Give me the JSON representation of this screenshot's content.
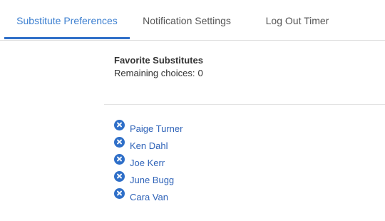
{
  "tabs": [
    {
      "label": "Substitute Preferences",
      "active": true
    },
    {
      "label": "Notification Settings",
      "active": false
    },
    {
      "label": "Log Out Timer",
      "active": false
    }
  ],
  "favorites": {
    "title": "Favorite Substitutes",
    "remaining_label": "Remaining choices:",
    "remaining_count": "0",
    "substitutes": [
      {
        "name": "Paige Turner",
        "remove_icon": "close-circle-icon"
      },
      {
        "name": "Ken Dahl",
        "remove_icon": "close-circle-icon"
      },
      {
        "name": "Joe Kerr",
        "remove_icon": "close-circle-icon"
      },
      {
        "name": "June Bugg",
        "remove_icon": "close-circle-icon"
      },
      {
        "name": "Cara Van",
        "remove_icon": "close-circle-icon"
      }
    ]
  },
  "colors": {
    "accent": "#2f6fc8",
    "link": "#2f63b8",
    "text": "#333333",
    "tab_inactive": "#555555"
  }
}
